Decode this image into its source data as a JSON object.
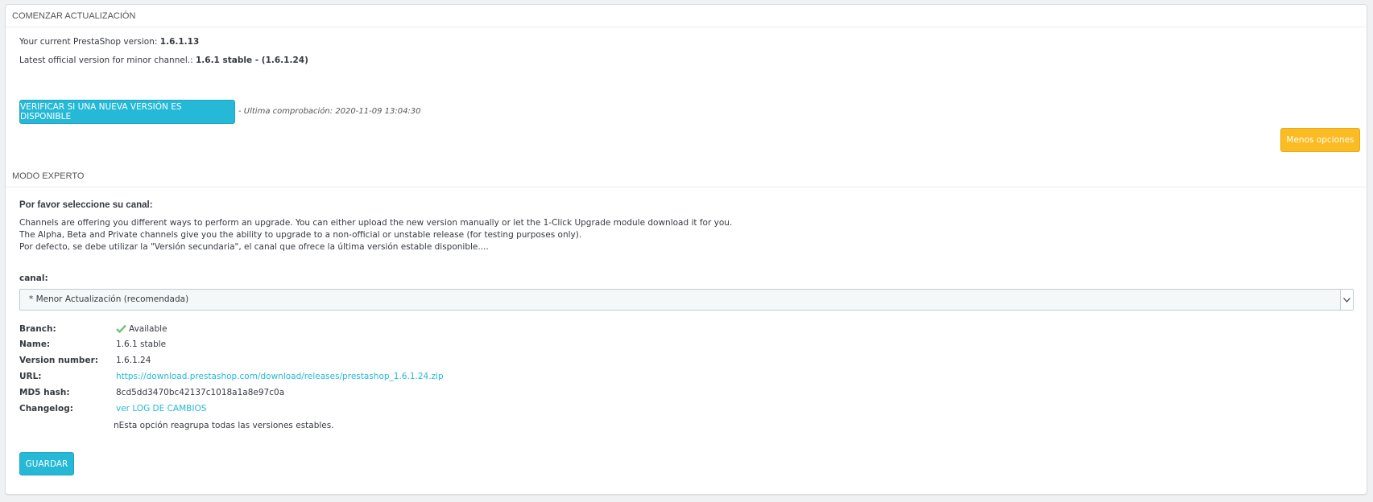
{
  "update_section": {
    "title": "COMENZAR ACTUALIZACIÓN",
    "current_version_label": "Your current PrestaShop version:",
    "current_version_value": "1.6.1.13",
    "latest_version_label": "Latest official version for minor channel.:",
    "latest_version_value": "1.6.1 stable - (1.6.1.24)",
    "check_button_label": "VERIFICAR SI UNA NUEVA VERSIÓN ES DISPONIBLE",
    "last_check_text": "- Ultima comprobación: 2020-11-09 13:04:30",
    "less_options_button_label": "Menos opciones"
  },
  "expert_section": {
    "title": "MODO EXPERTO",
    "subtitle": "Por favor seleccione su canal:",
    "description_lines": [
      "Channels are offering you different ways to perform an upgrade. You can either upload the new version manually or let the 1-Click Upgrade module download it for you.",
      "The Alpha, Beta and Private channels give you the ability to upgrade to a non-official or unstable release (for testing purposes only).",
      "Por defecto, se debe utilizar la \"Versión secundaria\", el canal que ofrece la última versión estable disponible...."
    ],
    "channel_label": "canal:",
    "channel_selected": "* Menor Actualización (recomendada)",
    "details": {
      "branch_label": "Branch:",
      "branch_value": "Available",
      "name_label": "Name:",
      "name_value": "1.6.1 stable",
      "version_label": "Version number:",
      "version_value": "1.6.1.24",
      "url_label": "URL:",
      "url_value": "https://download.prestashop.com/download/releases/prestashop_1.6.1.24.zip",
      "md5_label": "MD5 hash:",
      "md5_value": "8cd5dd3470bc42137c1018a1a8e97c0a",
      "changelog_label": "Changelog:",
      "changelog_value": "ver LOG DE CAMBIOS",
      "note": "nEsta opción reagrupa todas las versiones estables."
    },
    "save_button_label": "GUARDAR"
  },
  "colors": {
    "primary": "#25b9d7",
    "warning": "#fbbb22",
    "success": "#72c279",
    "text": "#363a41"
  },
  "icons": {
    "branch_status": "check-icon",
    "select_arrow": "chevron-down-icon"
  }
}
